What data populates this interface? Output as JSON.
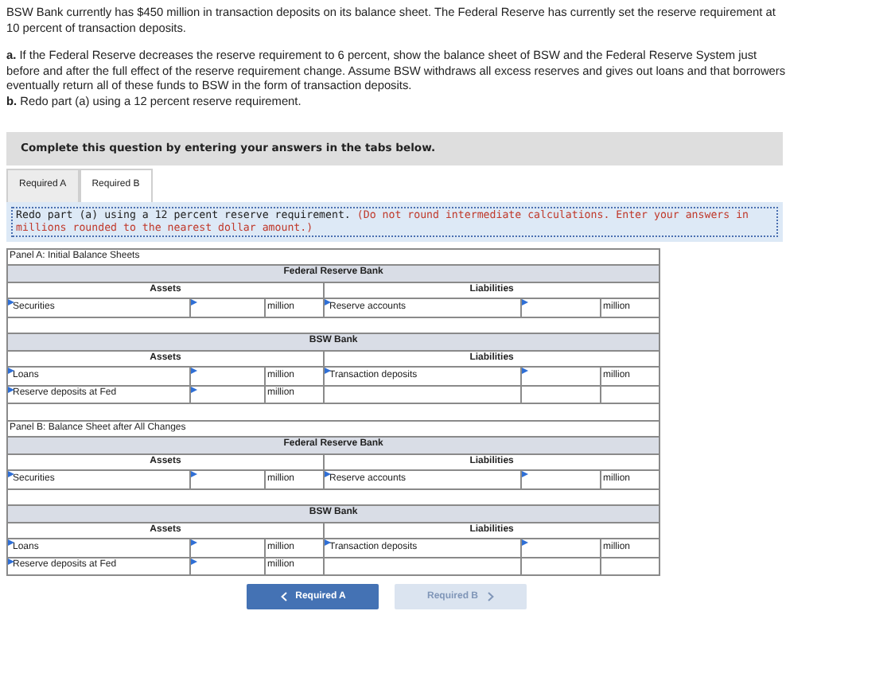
{
  "intro": [
    "BSW Bank currently has $450 million in transaction deposits on its balance sheet. The Federal Reserve has currently set the reserve requirement at 10 percent of transaction deposits.",
    "**a.** If the Federal Reserve decreases the reserve requirement to 6 percent, show the balance sheet of BSW and the Federal Reserve System just before and after the full effect of the reserve requirement change. Assume BSW withdraws all excess reserves and gives out loans and that borrowers eventually return all of these funds to BSW in the form of transaction deposits.",
    "**b.** Redo part (a) using a 12 percent reserve requirement."
  ],
  "instruction": "Complete this question by entering your answers in the tabs below.",
  "tabs": [
    {
      "label": "Required A",
      "selected": false
    },
    {
      "label": "Required B",
      "selected": true
    }
  ],
  "prompt": {
    "text": "Redo part (a) using a 12 percent reserve requirement.",
    "note": "(Do not round intermediate calculations. Enter your answers in millions rounded to the nearest dollar amount.)"
  },
  "panels": [
    {
      "title": "Panel A: Initial Balance Sheets",
      "banks": [
        {
          "name": "Federal Reserve Bank",
          "assets_heading": "Assets",
          "liabilities_heading": "Liabilities",
          "rows": [
            {
              "asset": {
                "label": "Securities",
                "unit": "million"
              },
              "liability": {
                "label": "Reserve accounts",
                "unit": "million"
              }
            }
          ]
        },
        {
          "name": "BSW Bank",
          "assets_heading": "Assets",
          "liabilities_heading": "Liabilities",
          "rows": [
            {
              "asset": {
                "label": "Loans",
                "unit": "million"
              },
              "liability": {
                "label": "Transaction deposits",
                "unit": "million"
              }
            },
            {
              "asset": {
                "label": "Reserve deposits at Fed",
                "unit": "million"
              },
              "liability": null
            }
          ]
        }
      ]
    },
    {
      "title": "Panel B: Balance Sheet after All Changes",
      "banks": [
        {
          "name": "Federal Reserve Bank",
          "assets_heading": "Assets",
          "liabilities_heading": "Liabilities",
          "rows": [
            {
              "asset": {
                "label": "Securities",
                "unit": "million"
              },
              "liability": {
                "label": "Reserve accounts",
                "unit": "million"
              }
            }
          ]
        },
        {
          "name": "BSW Bank",
          "assets_heading": "Assets",
          "liabilities_heading": "Liabilities",
          "rows": [
            {
              "asset": {
                "label": "Loans",
                "unit": "million"
              },
              "liability": {
                "label": "Transaction deposits",
                "unit": "million"
              }
            },
            {
              "asset": {
                "label": "Reserve deposits at Fed",
                "unit": "million"
              },
              "liability": null
            }
          ]
        }
      ]
    }
  ],
  "nav": [
    {
      "label": "Required A",
      "kind": "back",
      "disabled": false
    },
    {
      "label": "Required B",
      "kind": "forward",
      "disabled": true
    }
  ]
}
